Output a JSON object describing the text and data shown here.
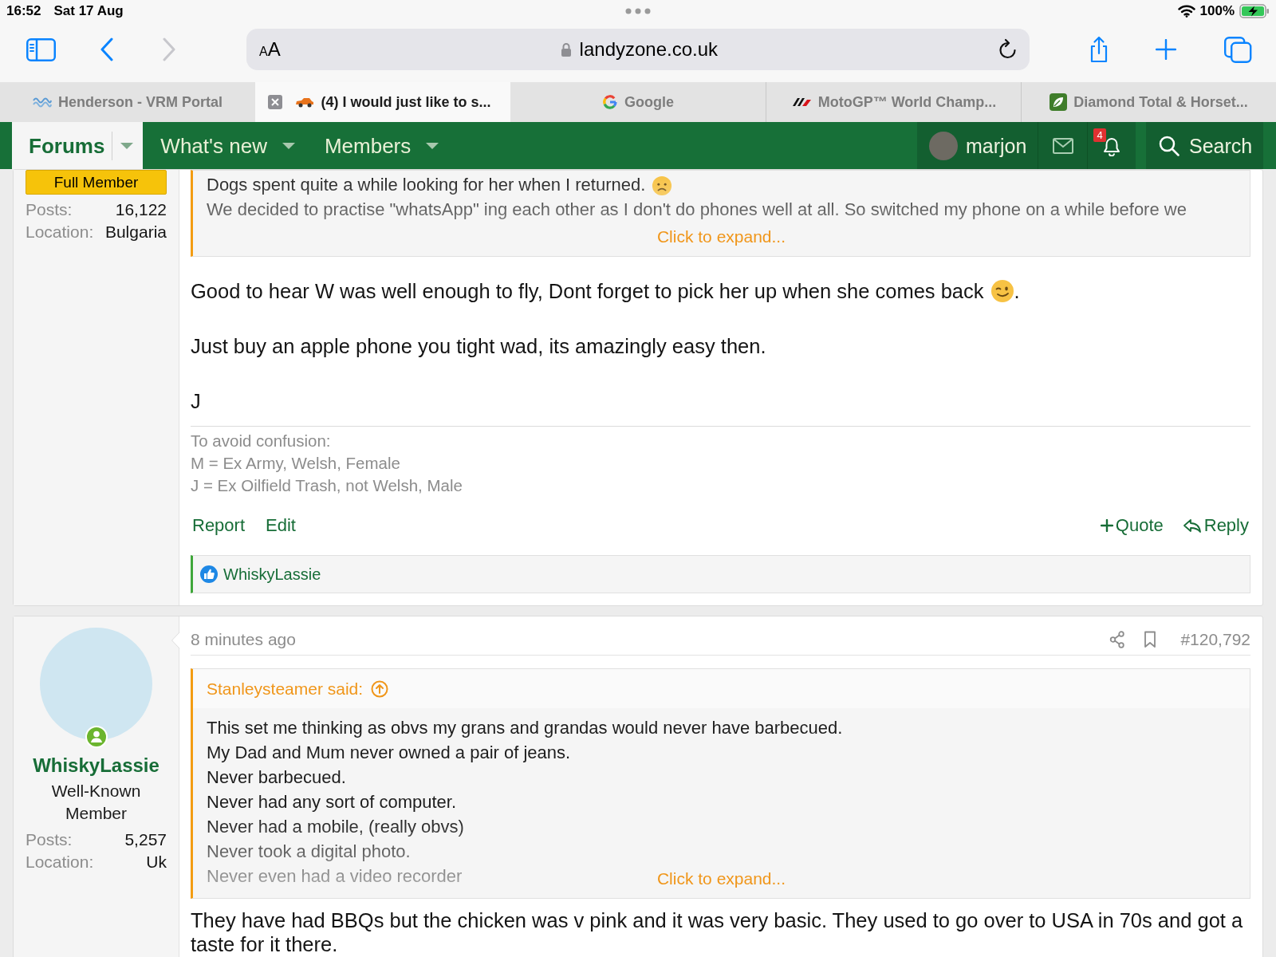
{
  "status_bar": {
    "time": "16:52",
    "date": "Sat 17 Aug",
    "battery": "100%"
  },
  "toolbar": {
    "nav_buttons": [
      {
        "kind": "back",
        "disabled": false
      },
      {
        "kind": "forward",
        "disabled": true
      }
    ],
    "text_size": "AA",
    "url": "landyzone.co.uk"
  },
  "tabs": [
    {
      "title": "Henderson - VRM Portal",
      "selected": false
    },
    {
      "title": "(4) I would just like to s...",
      "selected": true
    },
    {
      "title": "Google",
      "selected": false
    },
    {
      "title": "MotoGP™ World Champ...",
      "selected": false
    },
    {
      "title": "Diamond Total & Horset...",
      "selected": false
    }
  ],
  "nav": {
    "items": [
      {
        "label": "Forums",
        "selected": true
      },
      {
        "label": "What's new",
        "selected": false
      },
      {
        "label": "Members",
        "selected": false
      }
    ],
    "user": "marjon",
    "alerts_badge": "4",
    "search": "Search"
  },
  "posts": [
    {
      "user": {
        "banner": "Full Member",
        "stats": [
          {
            "label": "Posts:",
            "value": "16,122"
          },
          {
            "label": "Location:",
            "value": "Bulgaria"
          }
        ]
      },
      "quote": {
        "lines": [
          {
            "kind": "sad",
            "text": "Dogs spent quite a while looking for her when I returned."
          },
          {
            "kind": "plain",
            "text": "We decided to practise \"whatsApp\" ing each other as I don't do phones well at all. So switched my phone on a while before we"
          }
        ],
        "expand": "Click to expand..."
      },
      "body": [
        {
          "kind": "wink",
          "text": "Good to hear W was well enough to fly, Dont forget to pick her up when she comes back",
          "tail": "."
        },
        {
          "kind": "plain",
          "text": "Just buy an apple phone you tight wad, its amazingly easy then."
        },
        {
          "kind": "plain",
          "text": "J"
        }
      ],
      "signature": [
        "To avoid confusion:",
        "M = Ex Army, Welsh, Female",
        "J = Ex Oilfield Trash, not Welsh, Male"
      ],
      "actions": [
        {
          "label": "Report",
          "kind": "plain"
        },
        {
          "label": "Edit",
          "kind": "plain"
        },
        {
          "label": "Quote",
          "kind": "quote"
        },
        {
          "label": "Reply",
          "kind": "reply"
        }
      ],
      "reactions": {
        "users": "WhiskyLassie"
      }
    },
    {
      "user": {
        "name": "WhiskyLassie",
        "online": true,
        "title": "Well-Known Member",
        "stats": [
          {
            "label": "Posts:",
            "value": "5,257"
          },
          {
            "label": "Location:",
            "value": "Uk"
          }
        ]
      },
      "time": "8 minutes ago",
      "number": "#120,792",
      "quote": {
        "author": "Stanleysteamer said:",
        "lines": [
          {
            "kind": "plain",
            "text": "This set me thinking as obvs my grans and grandas would never have barbecued."
          },
          {
            "kind": "plain",
            "text": "My Dad and Mum never owned a pair of jeans."
          },
          {
            "kind": "plain",
            "text": "Never barbecued."
          },
          {
            "kind": "plain",
            "text": "Never had any sort of computer."
          },
          {
            "kind": "plain",
            "text": "Never had a mobile, (really obvs)"
          },
          {
            "kind": "plain",
            "text": "Never took a digital photo."
          },
          {
            "kind": "plain",
            "text": "Never even had a video recorder"
          }
        ],
        "expand": "Click to expand..."
      },
      "body": [
        {
          "kind": "plain",
          "text": "They have had BBQs but the chicken was v pink and it was very basic. They used to go over to USA in 70s and got a taste for it there."
        }
      ]
    }
  ]
}
